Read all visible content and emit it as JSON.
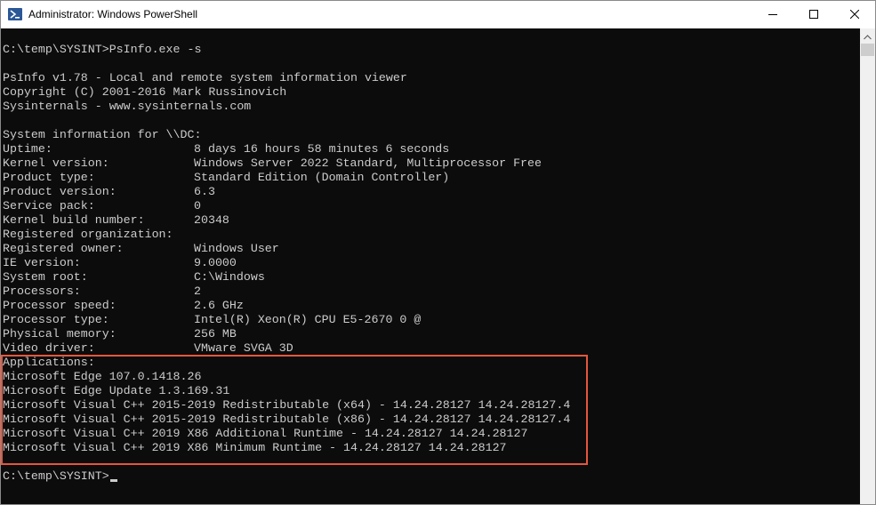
{
  "window": {
    "title": "Administrator: Windows PowerShell",
    "icon": "powershell-icon",
    "controls": [
      "minimize-icon",
      "maximize-icon",
      "close-icon"
    ]
  },
  "console": {
    "prompt_command": "C:\\temp\\SYSINT>PsInfo.exe -s",
    "banner": [
      "PsInfo v1.78 - Local and remote system information viewer",
      "Copyright (C) 2001-2016 Mark Russinovich",
      "Sysinternals - www.sysinternals.com"
    ],
    "system_info_header": "System information for \\\\DC:",
    "fields": [
      {
        "label": "Uptime:",
        "value": "8 days 16 hours 58 minutes 6 seconds"
      },
      {
        "label": "Kernel version:",
        "value": "Windows Server 2022 Standard, Multiprocessor Free"
      },
      {
        "label": "Product type:",
        "value": "Standard Edition (Domain Controller)"
      },
      {
        "label": "Product version:",
        "value": "6.3"
      },
      {
        "label": "Service pack:",
        "value": "0"
      },
      {
        "label": "Kernel build number:",
        "value": "20348"
      },
      {
        "label": "Registered organization:",
        "value": ""
      },
      {
        "label": "Registered owner:",
        "value": "Windows User"
      },
      {
        "label": "IE version:",
        "value": "9.0000"
      },
      {
        "label": "System root:",
        "value": "C:\\Windows"
      },
      {
        "label": "Processors:",
        "value": "2"
      },
      {
        "label": "Processor speed:",
        "value": "2.6 GHz"
      },
      {
        "label": "Processor type:",
        "value": "Intel(R) Xeon(R) CPU E5-2670 0 @"
      },
      {
        "label": "Physical memory:",
        "value": "256 MB"
      },
      {
        "label": "Video driver:",
        "value": "VMware SVGA 3D"
      }
    ],
    "applications_header": "Applications:",
    "applications": [
      "Microsoft Edge 107.0.1418.26",
      "Microsoft Edge Update 1.3.169.31",
      "Microsoft Visual C++ 2015-2019 Redistributable (x64) - 14.24.28127 14.24.28127.4",
      "Microsoft Visual C++ 2015-2019 Redistributable (x86) - 14.24.28127 14.24.28127.4",
      "Microsoft Visual C++ 2019 X86 Additional Runtime - 14.24.28127 14.24.28127",
      "Microsoft Visual C++ 2019 X86 Minimum Runtime - 14.24.28127 14.24.28127"
    ],
    "final_prompt": "C:\\temp\\SYSINT>"
  },
  "colors": {
    "console_bg": "#0c0c0c",
    "console_text": "#cccccc",
    "highlight_border": "#e4573d"
  }
}
